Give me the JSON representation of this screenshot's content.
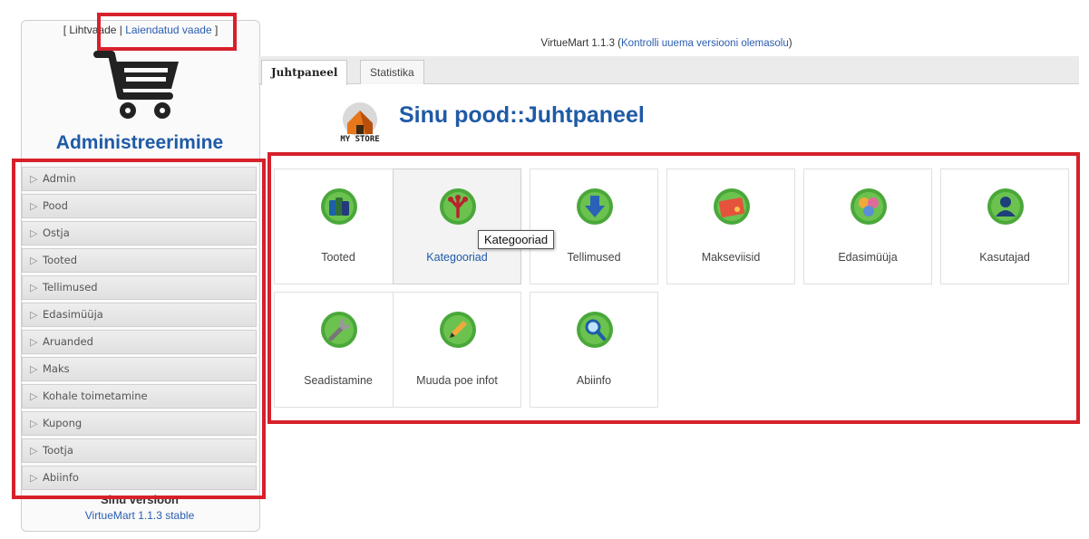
{
  "view_toggle": {
    "prefix": "[ Lihtvaade | ",
    "extended_link": "Laiendatud vaade",
    "suffix": " ]"
  },
  "sidebar": {
    "title": "Administreerimine",
    "items": [
      {
        "label": "Admin"
      },
      {
        "label": "Pood"
      },
      {
        "label": "Ostja"
      },
      {
        "label": "Tooted"
      },
      {
        "label": "Tellimused"
      },
      {
        "label": "Edasimüüja"
      },
      {
        "label": "Aruanded"
      },
      {
        "label": "Maks"
      },
      {
        "label": "Kohale toimetamine"
      },
      {
        "label": "Kupong"
      },
      {
        "label": "Tootja"
      },
      {
        "label": "Abiinfo"
      }
    ],
    "version_heading": "Sinu versioon",
    "version_text": "VirtueMart 1.1.3 stable"
  },
  "header": {
    "version_prefix": "VirtueMart 1.1.3 (",
    "version_link": "Kontrolli uuema versiooni olemasolu",
    "version_suffix": ")"
  },
  "tabs": [
    {
      "label": "Juhtpaneel",
      "active": true
    },
    {
      "label": "Statistika",
      "active": false
    }
  ],
  "store": {
    "title": "Sinu pood::Juhtpaneel",
    "icon_text": "MY STORE"
  },
  "tiles": [
    {
      "label": "Tooted",
      "icon": "products-icon"
    },
    {
      "label": "Kategooriad",
      "icon": "categories-icon"
    },
    {
      "label": "Tellimused",
      "icon": "orders-icon"
    },
    {
      "label": "Makseviisid",
      "icon": "payment-methods-icon"
    },
    {
      "label": "Edasimüüja",
      "icon": "vendor-icon"
    },
    {
      "label": "Kasutajad",
      "icon": "users-icon"
    },
    {
      "label": "Seadistamine",
      "icon": "configuration-icon"
    },
    {
      "label": "Muuda poe infot",
      "icon": "edit-store-icon"
    },
    {
      "label": "Abiinfo",
      "icon": "help-icon"
    }
  ],
  "tooltip": "Kategooriad",
  "colors": {
    "highlight_red": "#d7202b",
    "link_blue": "#2a5db0",
    "title_blue": "#1f5aa6",
    "icon_green": "#4aa83a"
  }
}
